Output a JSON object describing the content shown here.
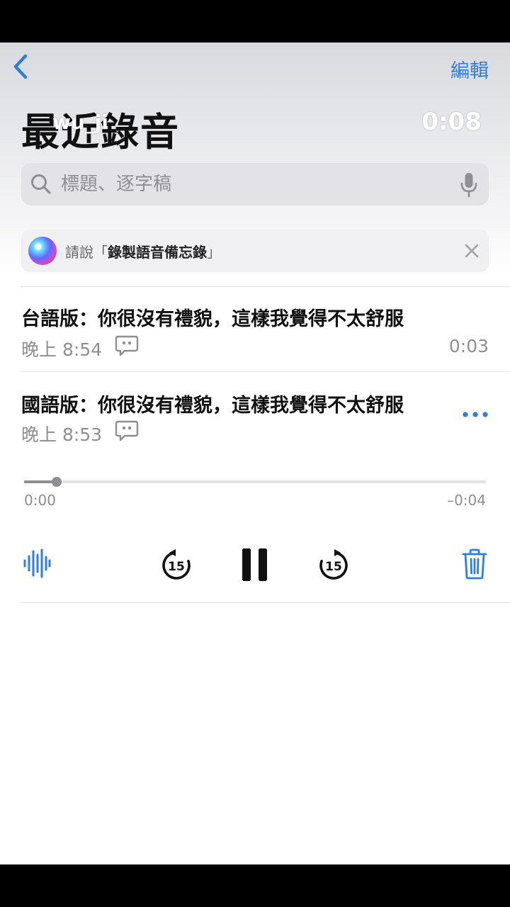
{
  "header": {
    "edit_label": "編輯",
    "title": "最近錄音",
    "overlay_name": "wu_ji",
    "overlay_time": "0:08"
  },
  "search": {
    "placeholder": "標題、逐字稿"
  },
  "siri": {
    "prefix": "請說「",
    "command": "錄製語音備忘錄",
    "suffix": "」"
  },
  "recordings": [
    {
      "title": "台語版：你很沒有禮貌，這樣我覺得不太舒服",
      "time": "晚上 8:54",
      "duration": "0:03"
    },
    {
      "title": "國語版：你很沒有禮貌，這樣我覺得不太舒服",
      "time": "晚上 8:53",
      "expanded": true,
      "playback": {
        "elapsed": "0:00",
        "remaining": "–0:04",
        "progress": 0.07
      }
    }
  ],
  "controls": {
    "skip_back_seconds": "15",
    "skip_forward_seconds": "15",
    "state": "playing"
  },
  "colors": {
    "accent": "#2f7de1",
    "secondary_text": "#8e8e93",
    "search_bg": "#e3e3e7"
  },
  "icons": [
    "back-icon",
    "search-icon",
    "mic-icon",
    "siri-icon",
    "close-icon",
    "transcript-icon",
    "more-icon",
    "waveform-icon",
    "skip-back-15-icon",
    "pause-icon",
    "skip-forward-15-icon",
    "trash-icon"
  ]
}
